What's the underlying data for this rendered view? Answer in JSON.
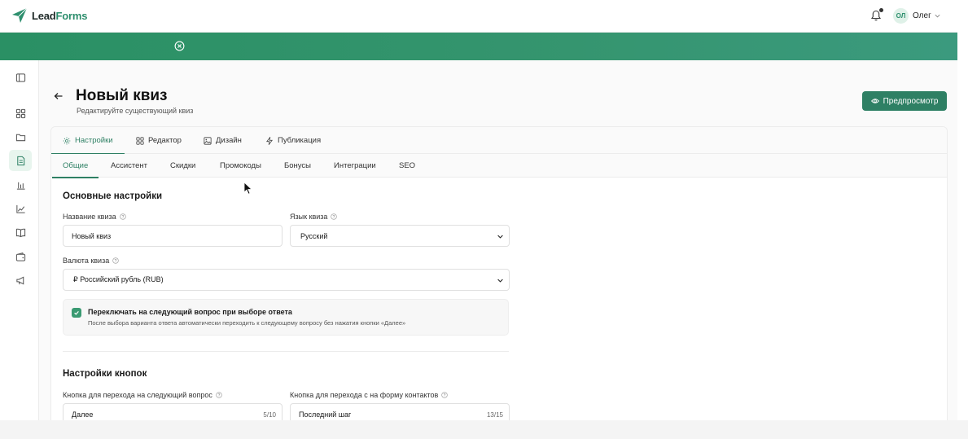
{
  "header": {
    "logo_lead": "Lead",
    "logo_forms": "Forms",
    "user_initials": "ОЛ",
    "user_name": "Олег"
  },
  "page": {
    "title": "Новый квиз",
    "subtitle": "Редактируйте существующий квиз",
    "preview_label": "Предпросмотр"
  },
  "tabs": [
    {
      "label": "Настройки",
      "icon": "gear-icon",
      "active": true
    },
    {
      "label": "Редактор",
      "icon": "grid-icon",
      "active": false
    },
    {
      "label": "Дизайн",
      "icon": "image-icon",
      "active": false
    },
    {
      "label": "Публикация",
      "icon": "bolt-icon",
      "active": false
    }
  ],
  "subtabs": [
    {
      "label": "Общие",
      "active": true
    },
    {
      "label": "Ассистент",
      "active": false
    },
    {
      "label": "Скидки",
      "active": false
    },
    {
      "label": "Промокоды",
      "active": false
    },
    {
      "label": "Бонусы",
      "active": false
    },
    {
      "label": "Интеграции",
      "active": false
    },
    {
      "label": "SEO",
      "active": false
    }
  ],
  "general": {
    "section_title": "Основные настройки",
    "quiz_name_label": "Название квиза",
    "quiz_name_value": "Новый квиз",
    "language_label": "Язык квиза",
    "language_value": "Русский",
    "currency_label": "Валюта квиза",
    "currency_value": "₽ Российский рубль (RUB)",
    "auto_next_title": "Переключать на следующий вопрос при выборе ответа",
    "auto_next_desc": "После выбора варианта ответа автоматически переходить к следующему вопросу без нажатия кнопки «Далее»",
    "auto_next_checked": true
  },
  "buttons": {
    "section_title": "Настройки кнопок",
    "next_label": "Кнопка для перехода на следующий вопрос",
    "next_value": "Далее",
    "next_counter": "5/10",
    "contacts_label": "Кнопка для перехода с на форму контактов",
    "contacts_value": "Последний шаг",
    "contacts_counter": "13/15"
  },
  "colors": {
    "brand": "#2e8064",
    "banner": "#35956f"
  }
}
